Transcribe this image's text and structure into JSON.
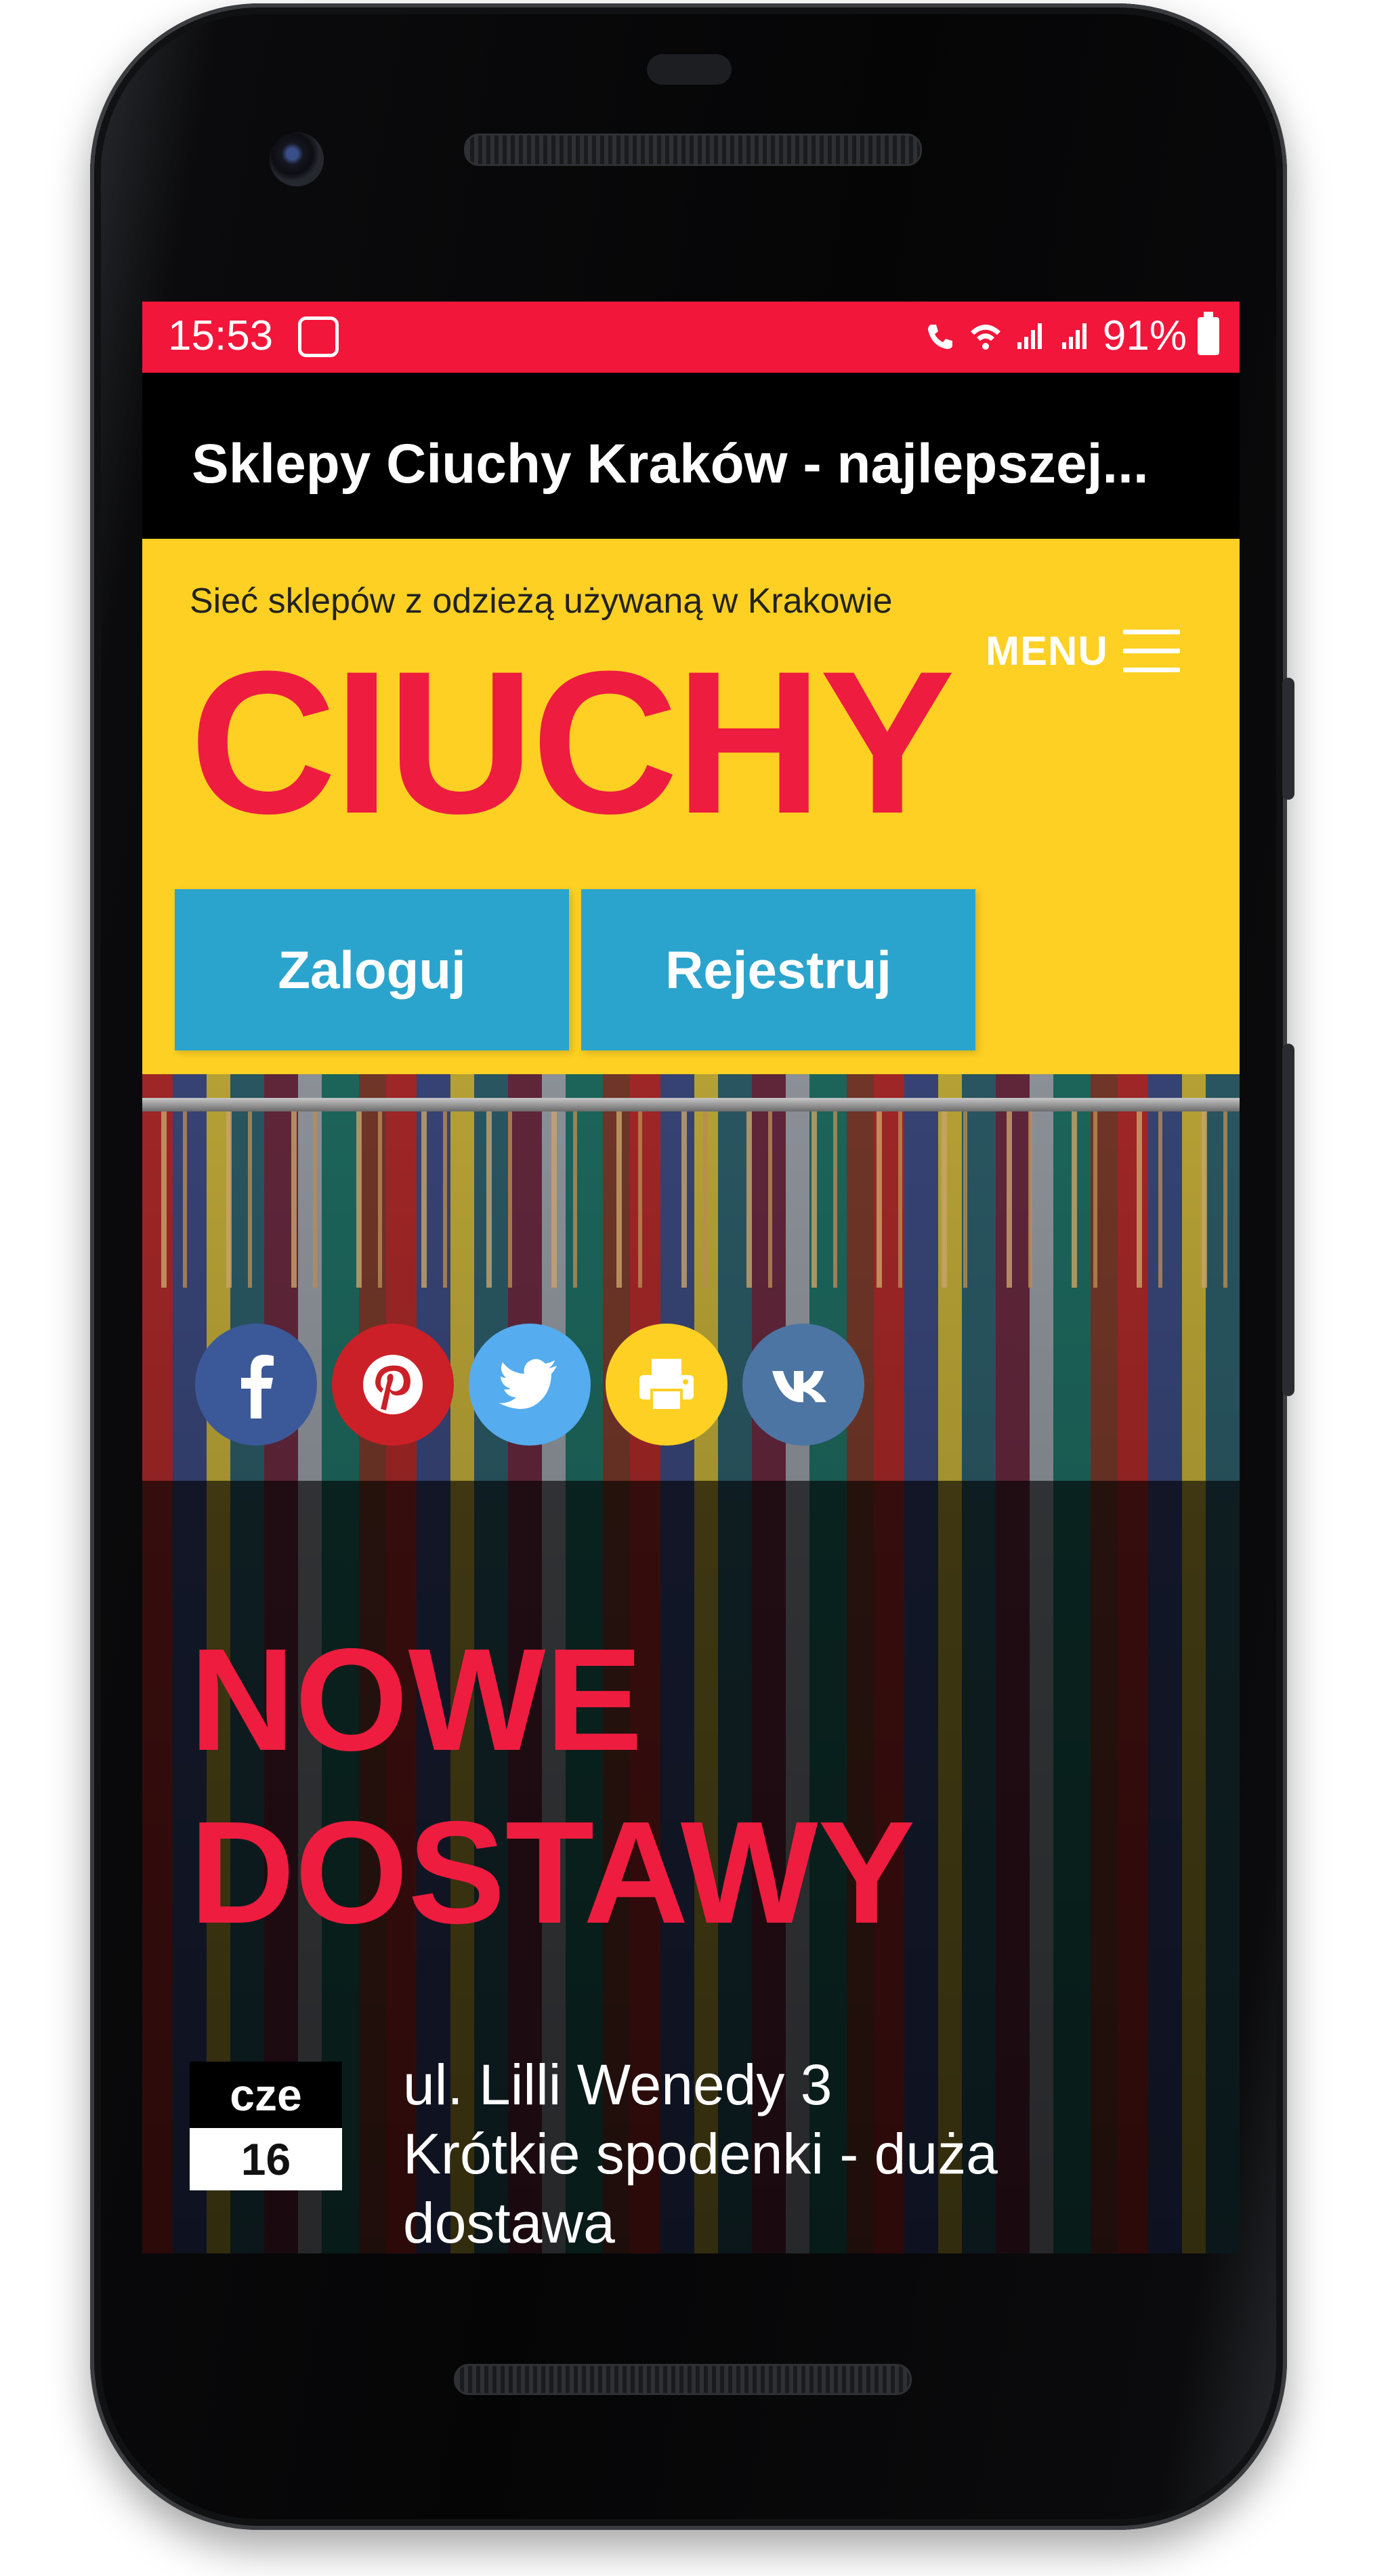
{
  "status_bar": {
    "time": "15:53",
    "battery": "91%"
  },
  "browser": {
    "page_title": "Sklepy Ciuchy Kraków - najlepszej..."
  },
  "header": {
    "tagline": "Sieć sklepów z odzieżą używaną w Krakowie",
    "logo": "CIUCHY",
    "menu_label": "MENU",
    "login_label": "Zaloguj",
    "register_label": "Rejestruj"
  },
  "social": [
    {
      "icon": "facebook-icon",
      "color": "#3b5998"
    },
    {
      "icon": "pinterest-icon",
      "color": "#cb2027"
    },
    {
      "icon": "twitter-icon",
      "color": "#55acee"
    },
    {
      "icon": "print-icon",
      "color": "#fdd023"
    },
    {
      "icon": "vk-icon",
      "color": "#4c75a3"
    }
  ],
  "hero": {
    "title_line1": "NOWE",
    "title_line2": "DOSTAWY"
  },
  "news": [
    {
      "month": "cze",
      "day": "16",
      "line1": "ul. Lilli Wenedy 3",
      "line2": "Krótkie spodenki - duża dostawa"
    }
  ],
  "colors": {
    "status_bar": "#f2163a",
    "header_bg": "#fdd023",
    "brand_red": "#ee1c3f",
    "button_blue": "#2ba4cd"
  }
}
